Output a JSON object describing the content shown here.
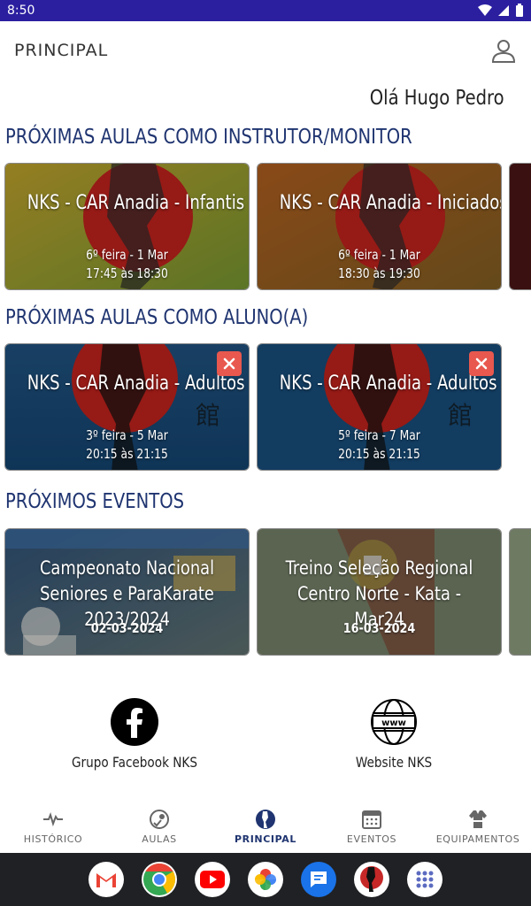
{
  "status": {
    "time": "8:50"
  },
  "appbar": {
    "title": "PRINCIPAL"
  },
  "greeting": "Olá Hugo Pedro",
  "sections": {
    "instructor_title": "PRÓXIMAS AULAS COMO INSTRUTOR/MONITOR",
    "student_title": "PRÓXIMAS AULAS COMO ALUNO(A)",
    "events_title": "PRÓXIMOS EVENTOS"
  },
  "instructor_classes": [
    {
      "name": "NKS - CAR Anadia - Infantis B",
      "day": "6º feira - 1 Mar",
      "time": "17:45 às 18:30"
    },
    {
      "name": "NKS - CAR Anadia - Iniciados",
      "day": "6º feira - 1 Mar",
      "time": "18:30 às 19:30"
    }
  ],
  "student_classes": [
    {
      "name": "NKS - CAR Anadia - Adultos",
      "day": "3º feira - 5 Mar",
      "time": "20:15 às 21:15"
    },
    {
      "name": "NKS - CAR Anadia - Adultos",
      "day": "5º feira - 7 Mar",
      "time": "20:15 às 21:15"
    }
  ],
  "events": [
    {
      "name": "Campeonato Nacional Seniores e ParaKarate 2023/2024",
      "date": "02-03-2024"
    },
    {
      "name": "Treino Seleção Regional Centro Norte - Kata - Mar24",
      "date": "16-03-2024"
    }
  ],
  "links": {
    "facebook_label": "Grupo Facebook NKS",
    "website_label": "Website NKS"
  },
  "nav": {
    "historico": "HISTÓRICO",
    "aulas": "AULAS",
    "principal": "PRINCIPAL",
    "eventos": "EVENTOS",
    "equipamentos": "EQUIPAMENTOS"
  },
  "colors": {
    "status_bar": "#2b1fa0",
    "section_title": "#1f3470",
    "close_button": "#e8584e"
  }
}
